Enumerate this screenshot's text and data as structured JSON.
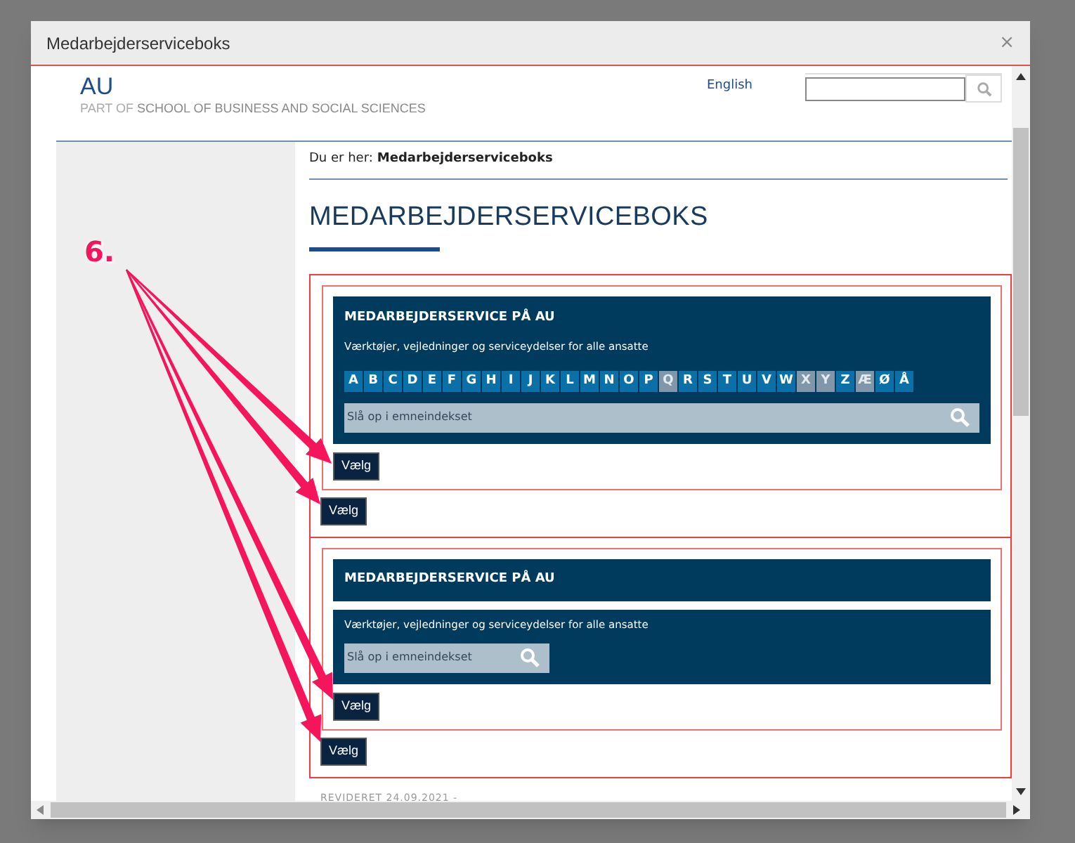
{
  "dialog": {
    "title": "Medarbejderserviceboks",
    "close": "×"
  },
  "header": {
    "logo": "AU",
    "subtitle_prefix": "PART OF",
    "subtitle": "SCHOOL OF BUSINESS AND SOCIAL SCIENCES",
    "language_link": "English"
  },
  "breadcrumb": {
    "label": "Du er her:",
    "current": "Medarbejderserviceboks"
  },
  "heading": "MEDARBEJDERSERVICEBOKS",
  "boxes": [
    {
      "kind": "alphabet",
      "title": "MEDARBEJDERSERVICE PÅ AU",
      "description": "Værktøjer, vejledninger og serviceydelser for alle ansatte",
      "letters": [
        {
          "label": "A",
          "disabled": false
        },
        {
          "label": "B",
          "disabled": false
        },
        {
          "label": "C",
          "disabled": false
        },
        {
          "label": "D",
          "disabled": false
        },
        {
          "label": "E",
          "disabled": false
        },
        {
          "label": "F",
          "disabled": false
        },
        {
          "label": "G",
          "disabled": false
        },
        {
          "label": "H",
          "disabled": false
        },
        {
          "label": "I",
          "disabled": false
        },
        {
          "label": "J",
          "disabled": false
        },
        {
          "label": "K",
          "disabled": false
        },
        {
          "label": "L",
          "disabled": false
        },
        {
          "label": "M",
          "disabled": false
        },
        {
          "label": "N",
          "disabled": false
        },
        {
          "label": "O",
          "disabled": false
        },
        {
          "label": "P",
          "disabled": false
        },
        {
          "label": "Q",
          "disabled": true
        },
        {
          "label": "R",
          "disabled": false
        },
        {
          "label": "S",
          "disabled": false
        },
        {
          "label": "T",
          "disabled": false
        },
        {
          "label": "U",
          "disabled": false
        },
        {
          "label": "V",
          "disabled": false
        },
        {
          "label": "W",
          "disabled": false
        },
        {
          "label": "X",
          "disabled": true
        },
        {
          "label": "Y",
          "disabled": true
        },
        {
          "label": "Z",
          "disabled": false
        },
        {
          "label": "Æ",
          "disabled": true
        },
        {
          "label": "Ø",
          "disabled": false
        },
        {
          "label": "Å",
          "disabled": false
        }
      ],
      "search": {
        "placeholder": "Slå op i emneindekset"
      },
      "inner_button": "Vælg",
      "outer_button": "Vælg"
    },
    {
      "kind": "compact",
      "title": "MEDARBEJDERSERVICE PÅ AU",
      "description": "Værktøjer, vejledninger og serviceydelser for alle ansatte",
      "search": {
        "placeholder": "Slå op i emneindekset"
      },
      "inner_button": "Vælg",
      "outer_button": "Vælg"
    }
  ],
  "footer": {
    "revised": "REVIDERET 24.09.2021 -"
  },
  "annotation": {
    "label": "6."
  }
}
